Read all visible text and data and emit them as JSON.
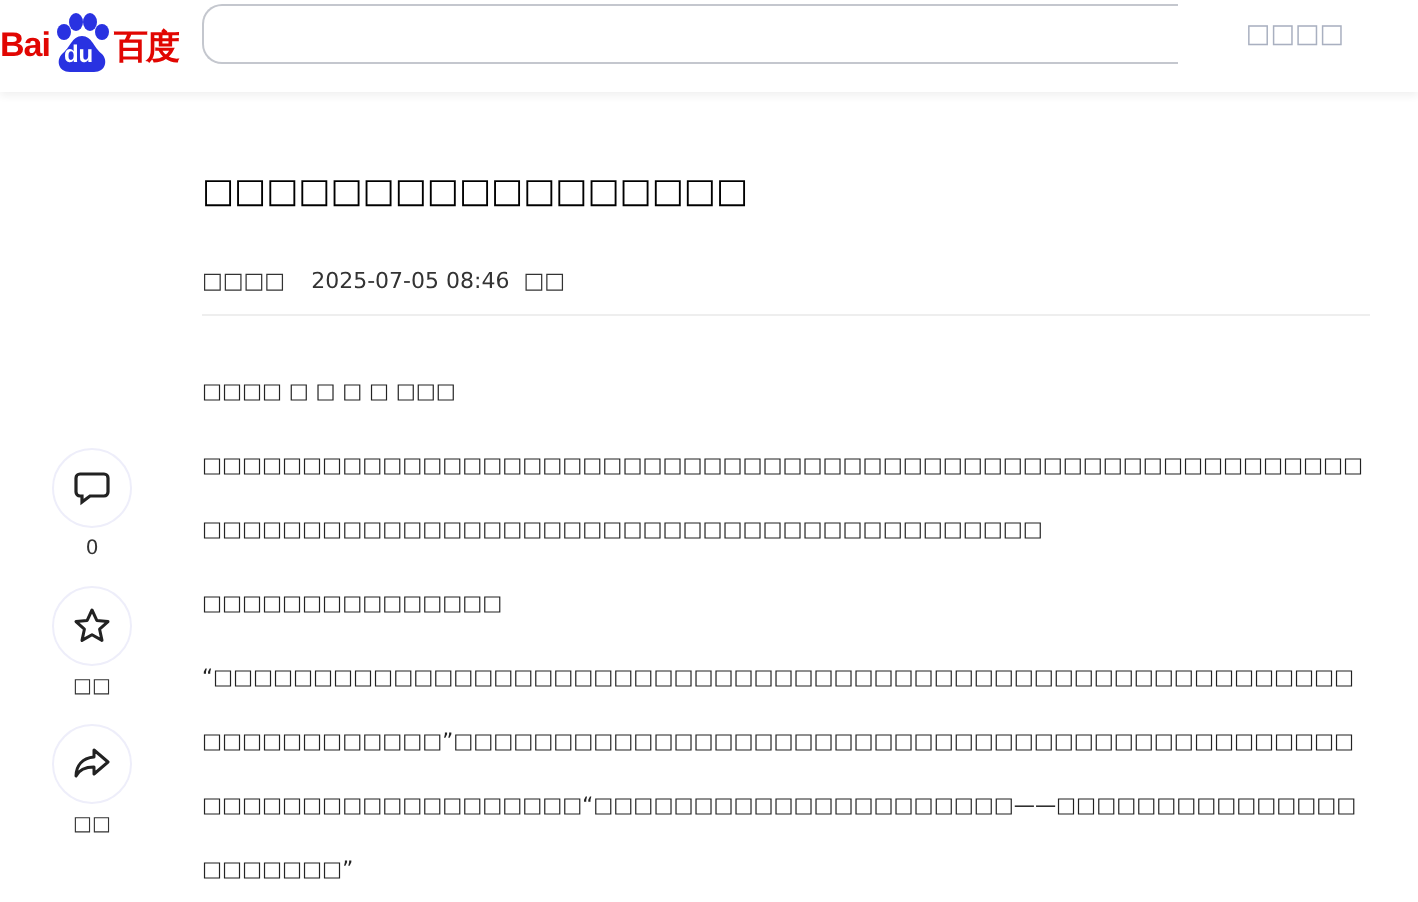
{
  "header": {
    "logo": {
      "left": "Bai",
      "paw": "du",
      "right": "百度"
    },
    "search": {
      "button": "□□□□"
    }
  },
  "actions": [
    {
      "kind": "comment",
      "label": "0"
    },
    {
      "kind": "star",
      "label": "□□"
    },
    {
      "kind": "share",
      "label": "□□"
    }
  ],
  "article": {
    "title": "□□□□□□□□□□□□□□□□□",
    "author": "□□□□",
    "time": "2025-07-05 08:46",
    "tag": "□□",
    "paragraphs": [
      {
        "kind": "byline",
        "text": "□□□□ □ □ □ □ □□□"
      },
      {
        "kind": "body",
        "text": "□□□□□□□□□□□□□□□□□□□□□□□□□□□□□□□□□□□□□□□□□□□□□□□□□□□□□□□□□□□□□□□□□□□□□□□□□□□□□□□□□□□□□□□□□□□□□□□□□□□□"
      },
      {
        "kind": "heading",
        "text": "□□□□□□□□□□□□□□□"
      },
      {
        "kind": "body",
        "text": "“□□□□□□□□□□□□□□□□□□□□□□□□□□□□□□□□□□□□□□□□□□□□□□□□□□□□□□□□□□□□□□□□□□□□□”□□□□□□□□□□□□□□□□□□□□□□□□□□□□□□□□□□□□□□□□□□□□□□□□□□□□□□□□□□□□□□□□“□□□□□□□□□□□□□□□□□□□□□——□□□□□□□□□□□□□□□□□□□□□□”"
      }
    ]
  }
}
